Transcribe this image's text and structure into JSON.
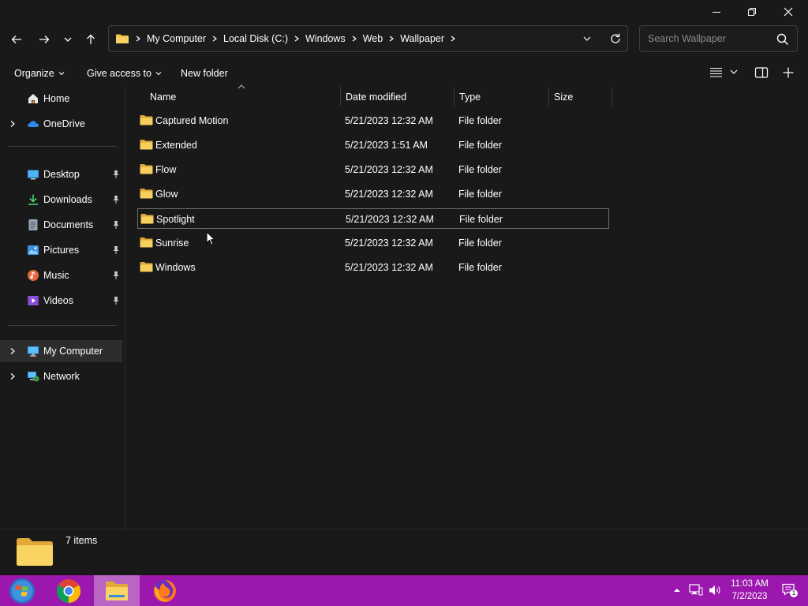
{
  "window": {
    "minimize_icon": "minimize-icon",
    "restore_icon": "restore-icon",
    "close_icon": "close-icon"
  },
  "address": {
    "crumbs": [
      "My Computer",
      "Local Disk (C:)",
      "Windows",
      "Web",
      "Wallpaper"
    ],
    "search_placeholder": "Search Wallpaper"
  },
  "commands": {
    "organize": "Organize",
    "give_access": "Give access to",
    "new_folder": "New folder"
  },
  "sidebar": {
    "items": [
      {
        "label": "Home",
        "icon": "home-icon"
      },
      {
        "label": "OneDrive",
        "icon": "cloud-icon"
      },
      {
        "label": "Desktop",
        "icon": "desktop-icon"
      },
      {
        "label": "Downloads",
        "icon": "download-icon"
      },
      {
        "label": "Documents",
        "icon": "documents-icon"
      },
      {
        "label": "Pictures",
        "icon": "pictures-icon"
      },
      {
        "label": "Music",
        "icon": "music-icon"
      },
      {
        "label": "Videos",
        "icon": "videos-icon"
      },
      {
        "label": "My Computer",
        "icon": "computer-icon"
      },
      {
        "label": "Network",
        "icon": "network-icon"
      }
    ]
  },
  "columns": {
    "name": "Name",
    "date": "Date modified",
    "type": "Type",
    "size": "Size"
  },
  "files": [
    {
      "name": "Captured Motion",
      "date": "5/21/2023 12:32 AM",
      "type": "File folder"
    },
    {
      "name": "Extended",
      "date": "5/21/2023 1:51 AM",
      "type": "File folder"
    },
    {
      "name": "Flow",
      "date": "5/21/2023 12:32 AM",
      "type": "File folder"
    },
    {
      "name": "Glow",
      "date": "5/21/2023 12:32 AM",
      "type": "File folder"
    },
    {
      "name": "Spotlight",
      "date": "5/21/2023 12:32 AM",
      "type": "File folder"
    },
    {
      "name": "Sunrise",
      "date": "5/21/2023 12:32 AM",
      "type": "File folder"
    },
    {
      "name": "Windows",
      "date": "5/21/2023 12:32 AM",
      "type": "File folder"
    }
  ],
  "status": {
    "item_count": "7 items"
  },
  "taskbar": {
    "time": "11:03 AM",
    "date": "7/2/2023",
    "notification_count": "1"
  },
  "colors": {
    "background": "#191919",
    "taskbar": "#9b17ad",
    "folder": "#f3c14b"
  }
}
